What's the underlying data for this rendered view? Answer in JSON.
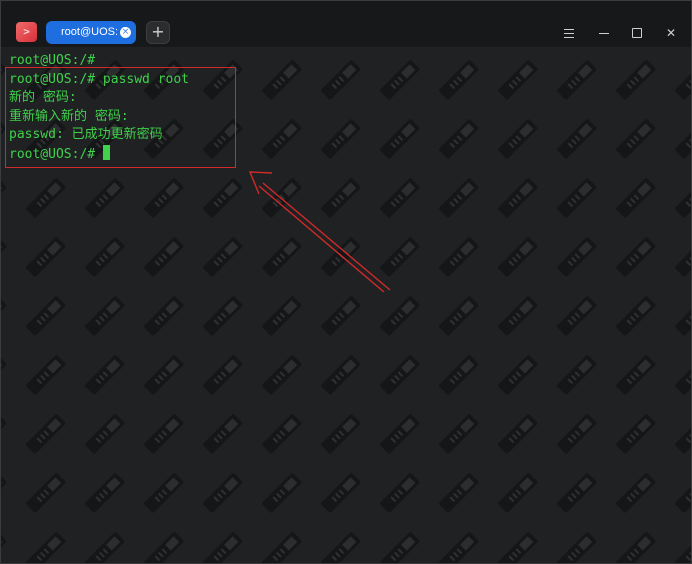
{
  "window": {
    "tab_label": "root@UOS: /",
    "tab_close_glyph": "×",
    "new_tab_glyph": "+",
    "close_glyph": "✕"
  },
  "terminal": {
    "lines": [
      "root@UOS:/#",
      "root@UOS:/# passwd root",
      "新的 密码:",
      "重新输入新的 密码:",
      "passwd: 已成功更新密码",
      "root@UOS:/#"
    ],
    "text_color": "#3fd24a"
  },
  "annotation": {
    "highlight_color": "#d02a2a"
  }
}
